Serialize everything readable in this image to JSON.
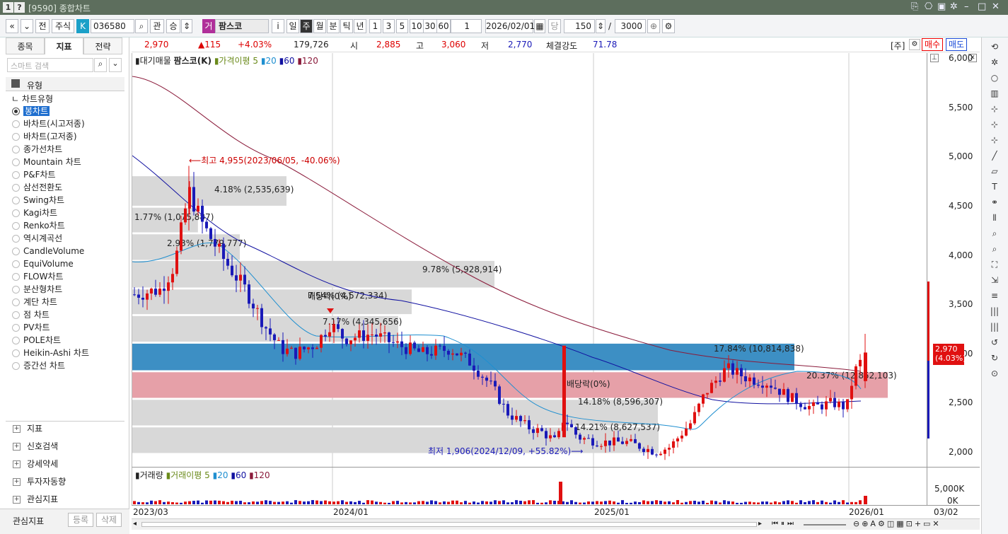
{
  "title": {
    "badge1": "1",
    "badge2": "?",
    "text": "[9590] 종합차트"
  },
  "toolbar": {
    "nav_prev": "«",
    "nav_next": "»",
    "chart_mode": "전",
    "market": "주식",
    "k_badge": "K",
    "code": "036580",
    "search": "⌕",
    "gwan": "관",
    "seung": "승",
    "name_tag": "거",
    "name": "팜스코",
    "info": "i",
    "periods": [
      "일",
      "주",
      "월",
      "분",
      "틱",
      "년"
    ],
    "active_period": "주",
    "nums": [
      "1",
      "3",
      "5",
      "10",
      "30",
      "60"
    ],
    "unit": "1",
    "date": "2026/02/01",
    "dang": "당",
    "count": "150",
    "total": "3000"
  },
  "left": {
    "tabs": [
      "종목",
      "지표",
      "전략"
    ],
    "search_placeholder": "스마트 검색",
    "section_header": "유형",
    "tree_header": "차트유형",
    "chart_types": [
      "봉차트",
      "바차트(시고저종)",
      "바차트(고저종)",
      "종가선차트",
      "Mountain 차트",
      "P&F차트",
      "삼선전환도",
      "Swing차트",
      "Kagi차트",
      "Renko차트",
      "역시계곡선",
      "CandleVolume",
      "EquiVolume",
      "FLOW차트",
      "분산형차트",
      "계단 차트",
      "점 차트",
      "PV차트",
      "POLE차트",
      "Heikin-Ashi 차트",
      "증간선 차트"
    ],
    "groups": [
      "지표",
      "신호검색",
      "강세약세",
      "투자자동향",
      "관심지표"
    ],
    "footer_label": "관심지표",
    "btn_register": "등록",
    "btn_delete": "삭제"
  },
  "info": {
    "price": "2,970",
    "change": "▲115",
    "pct": "+4.03%",
    "volume": "179,726",
    "open_lbl": "시",
    "open": "2,885",
    "high_lbl": "고",
    "high": "3,060",
    "low_lbl": "저",
    "low": "2,770",
    "strength_lbl": "체결강도",
    "strength": "71.78",
    "ju": "[주]",
    "buy": "매수",
    "sell": "매도"
  },
  "legend": {
    "price": "▮대기매물",
    "name": "팜스코(K)",
    "ma_lbl": "가격이평 5",
    "ma20": "20",
    "ma60": "60",
    "ma120": "120"
  },
  "vol_legend": {
    "lbl": "거래량",
    "ma_lbl": "거래이평 5",
    "ma20": "20",
    "ma60": "60",
    "ma120": "120"
  },
  "annotations": {
    "high": "⟵최고 4,955(2023/06/05, -40.06%)",
    "low": "최저 1,906(2024/12/09, +55.82%)⟶",
    "div1": "배당락(0%)",
    "div2": "배당락(0%)",
    "last_price": "2,970",
    "last_pct": "(4.03%)"
  },
  "vp": [
    {
      "label": "4.18% (2,535,639)",
      "pct": 4.18
    },
    {
      "label": "1.77% (1,075,887)",
      "pct": 1.77
    },
    {
      "label": "2.93% (1,779,777)",
      "pct": 2.93
    },
    {
      "label": "9.78% (5,928,914)",
      "pct": 9.78
    },
    {
      "label": "7.54% (4,572,334)",
      "pct": 7.54
    },
    {
      "label": "7.17% (4,345,656)",
      "pct": 7.17
    },
    {
      "label": "17.84% (10,814,838)",
      "pct": 17.84
    },
    {
      "label": "20.37% (12,852,103)",
      "pct": 20.37
    },
    {
      "label": "14.18% (8,596,307)",
      "pct": 14.18
    },
    {
      "label": "14.21% (8,627,537)",
      "pct": 14.21
    }
  ],
  "y_ticks": [
    "6,000",
    "5,500",
    "5,000",
    "4,500",
    "4,000",
    "3,500",
    "3,000",
    "2,500",
    "2,000"
  ],
  "vol_ticks": [
    "5,000K",
    "0K"
  ],
  "x_ticks": [
    "2023/03",
    "2024/01",
    "2025/01",
    "2026/01",
    "03/02"
  ],
  "colors": {
    "up": "#e01010",
    "down": "#1a1ab8",
    "ma5": "#6a8a1a",
    "ma20": "#1f8fd0",
    "ma60": "#1010a0",
    "ma120": "#8a1a3a",
    "band_blue": "#3d8fc4",
    "band_pink": "#e6a0a8",
    "band_gray": "#d8d8d8"
  },
  "chart_data": {
    "type": "candlestick",
    "period": "weekly",
    "ylim": [
      1900,
      6100
    ],
    "high": 4955,
    "low": 1906,
    "last": 2970
  }
}
